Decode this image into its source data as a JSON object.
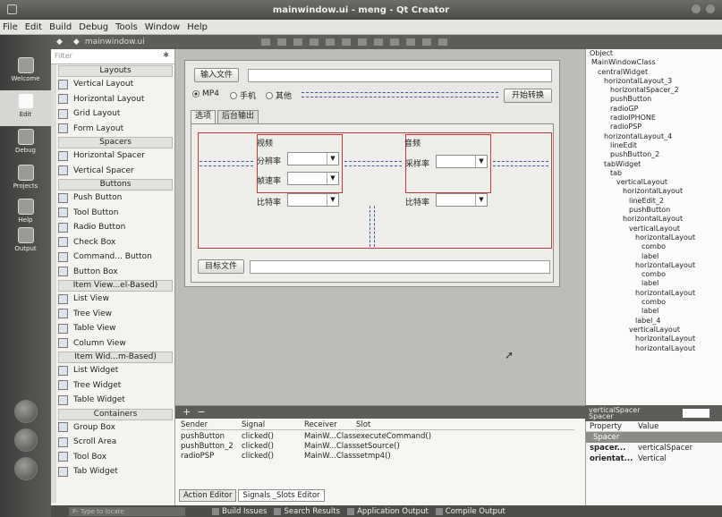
{
  "window": {
    "title": "mainwindow.ui - meng - Qt Creator"
  },
  "menu": [
    "File",
    "Edit",
    "Build",
    "Debug",
    "Tools",
    "Window",
    "Help"
  ],
  "modes": [
    {
      "label": "Welcome",
      "icon": "welcome-icon"
    },
    {
      "label": "Edit",
      "icon": "edit-icon"
    },
    {
      "label": "Debug",
      "icon": "debug-icon"
    },
    {
      "label": "Projects",
      "icon": "projects-icon"
    },
    {
      "label": "Help",
      "icon": "help-icon"
    },
    {
      "label": "Output",
      "icon": "output-icon"
    }
  ],
  "editor": {
    "file_tab": "mainwindow.ui"
  },
  "widget_box": {
    "filter_placeholder": "Filter",
    "sections": [
      {
        "title": "Layouts",
        "items": [
          "Vertical Layout",
          "Horizontal Layout",
          "Grid Layout",
          "Form Layout"
        ]
      },
      {
        "title": "Spacers",
        "items": [
          "Horizontal Spacer",
          "Vertical Spacer"
        ]
      },
      {
        "title": "Buttons",
        "items": [
          "Push Button",
          "Tool Button",
          "Radio Button",
          "Check Box",
          "Command... Button",
          "Button Box"
        ]
      },
      {
        "title": "Item View...el-Based)",
        "items": [
          "List View",
          "Tree View",
          "Table View",
          "Column View"
        ]
      },
      {
        "title": "Item Wid...m-Based)",
        "items": [
          "List Widget",
          "Tree Widget",
          "Table Widget"
        ]
      },
      {
        "title": "Containers",
        "items": [
          "Group Box",
          "Scroll Area",
          "Tool Box",
          "Tab Widget"
        ]
      }
    ]
  },
  "form": {
    "input_file_button": "输入文件",
    "start_convert_button": "开始转换",
    "radios": [
      {
        "label": "MP4",
        "checked": true
      },
      {
        "label": "手机",
        "checked": false
      },
      {
        "label": "其他",
        "checked": false
      }
    ],
    "tabs": [
      "选项",
      "后台输出"
    ],
    "video_header": "视频",
    "audio_header": "音频",
    "resolution_label": "分辨率",
    "framerate_label": "帧速率",
    "video_bitrate_label": "比特率",
    "samplerate_label": "采样率",
    "audio_bitrate_label": "比特率",
    "target_file_button": "目标文件"
  },
  "signals": {
    "headers": [
      "Sender",
      "Signal",
      "Receiver",
      "Slot"
    ],
    "rows": [
      [
        "pushButton",
        "clicked()",
        "MainW...Class",
        "executeCommand()"
      ],
      [
        "pushButton_2",
        "clicked()",
        "MainW...Class",
        "setSource()"
      ],
      [
        "radioPSP",
        "clicked()",
        "MainW...Class",
        "setmp4()"
      ]
    ],
    "tabs": [
      "Action Editor",
      "Signals _Slots Editor"
    ]
  },
  "object_inspector": {
    "title": "Object",
    "items": [
      {
        "t": "MainWindowClass",
        "d": 0
      },
      {
        "t": "centralWidget",
        "d": 1
      },
      {
        "t": "horizontalLayout_3",
        "d": 2
      },
      {
        "t": "horizontalSpacer_2",
        "d": 3
      },
      {
        "t": "pushButton",
        "d": 3
      },
      {
        "t": "radioGP",
        "d": 3
      },
      {
        "t": "radioIPHONE",
        "d": 3
      },
      {
        "t": "radioPSP",
        "d": 3
      },
      {
        "t": "horizontalLayout_4",
        "d": 2
      },
      {
        "t": "lineEdit",
        "d": 3
      },
      {
        "t": "pushButton_2",
        "d": 3
      },
      {
        "t": "tabWidget",
        "d": 2
      },
      {
        "t": "tab",
        "d": 3
      },
      {
        "t": "verticalLayout",
        "d": 4
      },
      {
        "t": "horizontalLayout",
        "d": 5
      },
      {
        "t": "lineEdit_2",
        "d": 6
      },
      {
        "t": "pushButton",
        "d": 6
      },
      {
        "t": "horizontalLayout",
        "d": 5
      },
      {
        "t": "verticalLayout",
        "d": 6
      },
      {
        "t": "horizontalLayout",
        "d": 7
      },
      {
        "t": "combo",
        "d": 8
      },
      {
        "t": "label",
        "d": 8
      },
      {
        "t": "horizontalLayout",
        "d": 7
      },
      {
        "t": "combo",
        "d": 8
      },
      {
        "t": "label",
        "d": 8
      },
      {
        "t": "horizontalLayout",
        "d": 7
      },
      {
        "t": "combo",
        "d": 8
      },
      {
        "t": "label",
        "d": 8
      },
      {
        "t": "label_4",
        "d": 7
      },
      {
        "t": "verticalLayout",
        "d": 6
      },
      {
        "t": "horizontalLayout",
        "d": 7
      },
      {
        "t": "horizontalLayout",
        "d": 7
      }
    ]
  },
  "property_editor": {
    "header": "verticalSpacer",
    "subheader": "Spacer",
    "columns": [
      "Property",
      "Value"
    ],
    "group": "Spacer",
    "rows": [
      [
        "spacer...",
        "verticalSpacer"
      ],
      [
        "orientat...",
        "Vertical"
      ]
    ]
  },
  "status": {
    "locator_placeholder": "P- Type to locate",
    "panes": [
      "Build Issues",
      "Search Results",
      "Application Output",
      "Compile Output"
    ]
  }
}
